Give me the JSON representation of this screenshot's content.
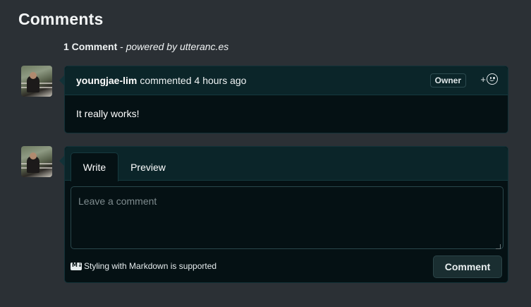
{
  "section": {
    "title": "Comments",
    "count_label": "1 Comment",
    "separator": " - ",
    "powered_by_prefix": "powered by ",
    "powered_by_link": "utteranc.es"
  },
  "comment": {
    "author": "youngjae-lim",
    "action": "commented",
    "time": "4 hours ago",
    "badge": "Owner",
    "reaction_plus": "+",
    "body": "It really works!"
  },
  "new_comment": {
    "tab_write": "Write",
    "tab_preview": "Preview",
    "placeholder": "Leave a comment",
    "markdown_note": "Styling with Markdown is supported",
    "submit_label": "Comment"
  },
  "icons": {
    "reaction": "smiley-icon",
    "markdown": "markdown-icon",
    "avatar": "avatar"
  },
  "colors": {
    "page_bg": "#2b3035",
    "card_bg": "#051114",
    "header_bg": "#0b2529",
    "border": "#16393e"
  }
}
